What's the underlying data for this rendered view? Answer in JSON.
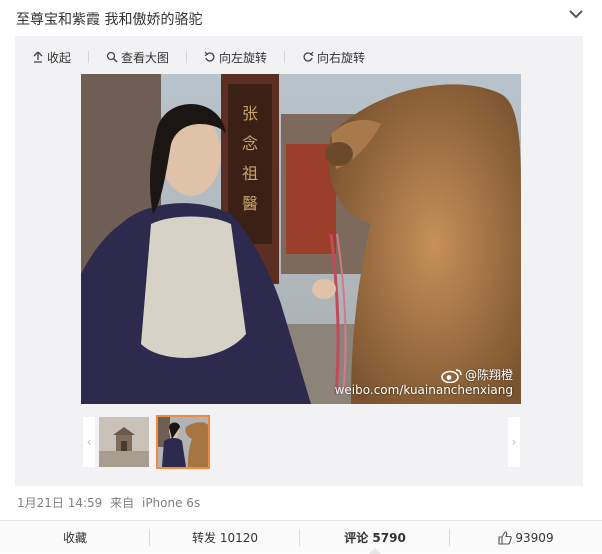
{
  "post": {
    "text": "至尊宝和紫霞 我和傲娇的骆驼"
  },
  "toolbar": {
    "collapse": "收起",
    "view_large": "查看大图",
    "rotate_left": "向左旋转",
    "rotate_right": "向右旋转"
  },
  "photo": {
    "watermark_user": "@陈翔橙",
    "watermark_url": "weibo.com/kuainanchenxiang"
  },
  "thumbnails": {
    "count": 2,
    "selected_index": 1
  },
  "meta": {
    "time": "1月21日 14:59",
    "from_label": "来自",
    "device": "iPhone 6s"
  },
  "actions": {
    "favorite": "收藏",
    "repost_label": "转发",
    "repost_count": "10120",
    "comment_label": "评论",
    "comment_count": "5790",
    "like_count": "93909"
  },
  "colors": {
    "accent_orange": "#f08a3c",
    "panel_bg": "#f2f2f5",
    "text_gray": "#808080"
  }
}
